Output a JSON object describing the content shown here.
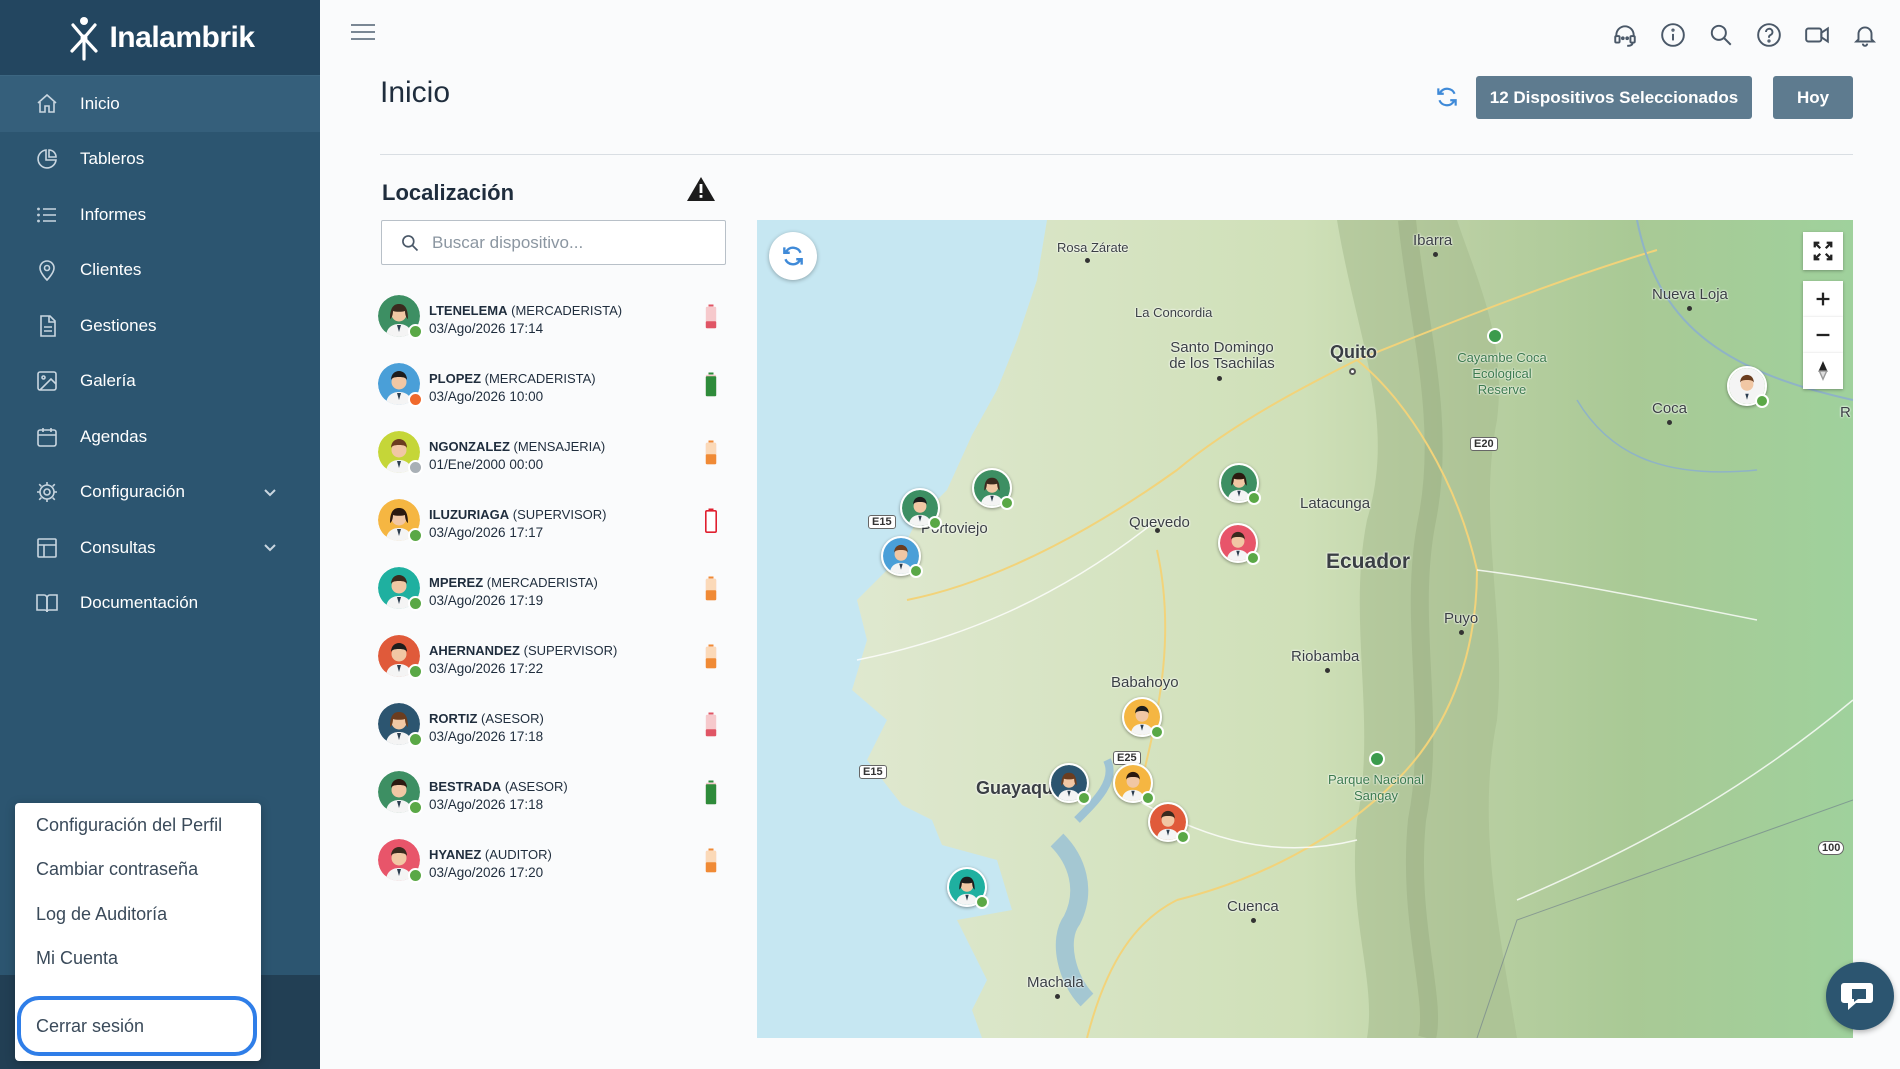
{
  "app": {
    "brand": "Inalambrik"
  },
  "sidebar": {
    "items": [
      {
        "label": "Inicio",
        "icon": "home-icon",
        "active": true
      },
      {
        "label": "Tableros",
        "icon": "pie-chart-icon"
      },
      {
        "label": "Informes",
        "icon": "list-icon"
      },
      {
        "label": "Clientes",
        "icon": "location-pin-icon"
      },
      {
        "label": "Gestiones",
        "icon": "document-icon"
      },
      {
        "label": "Galería",
        "icon": "image-icon"
      },
      {
        "label": "Agendas",
        "icon": "calendar-icon"
      },
      {
        "label": "Configuración",
        "icon": "gear-icon",
        "expandable": true
      },
      {
        "label": "Consultas",
        "icon": "table-icon",
        "expandable": true
      },
      {
        "label": "Documentación",
        "icon": "book-icon"
      }
    ]
  },
  "profile_menu": {
    "items": [
      "Configuración del Perfil",
      "Cambiar contraseña",
      "Log de Auditoría",
      "Mi Cuenta"
    ],
    "logout": "Cerrar sesión"
  },
  "header": {
    "title": "Inicio",
    "devices_button": "12 Dispositivos Seleccionados",
    "today_button": "Hoy",
    "icons": [
      "headset-icon",
      "info-icon",
      "search-icon",
      "help-icon",
      "video-icon",
      "bell-icon"
    ]
  },
  "localization": {
    "title": "Localización",
    "search_placeholder": "Buscar dispositivo...",
    "devices": [
      {
        "user": "LTENELEMA",
        "role": "(MERCADERISTA)",
        "date": "03/Ago/2026 17:14",
        "status_color": "#5aa846",
        "battery": "low",
        "battery_color": "#e05565",
        "avatar_bg": "#3d8f63"
      },
      {
        "user": "PLOPEZ",
        "role": "(MERCADERISTA)",
        "date": "03/Ago/2026 10:00",
        "status_color": "#f0692c",
        "battery": "full",
        "battery_color": "#2e8b3a",
        "avatar_bg": "#4a9fd8"
      },
      {
        "user": "NGONZALEZ",
        "role": "(MENSAJERIA)",
        "date": "01/Ene/2000 00:00",
        "status_color": "#a9b0b6",
        "battery": "medium",
        "battery_color": "#f08a35",
        "avatar_bg": "#c5d638"
      },
      {
        "user": "ILUZURIAGA",
        "role": "(SUPERVISOR)",
        "date": "03/Ago/2026 17:17",
        "status_color": "#5aa846",
        "battery": "empty",
        "battery_color": "#e02030",
        "avatar_bg": "#f5b642"
      },
      {
        "user": "MPEREZ",
        "role": "(MERCADERISTA)",
        "date": "03/Ago/2026 17:19",
        "status_color": "#5aa846",
        "battery": "medium",
        "battery_color": "#f08a35",
        "avatar_bg": "#1fb0a0"
      },
      {
        "user": "AHERNANDEZ",
        "role": "(SUPERVISOR)",
        "date": "03/Ago/2026 17:22",
        "status_color": "#5aa846",
        "battery": "medium",
        "battery_color": "#f08a35",
        "avatar_bg": "#e05a3a"
      },
      {
        "user": "RORTIZ",
        "role": "(ASESOR)",
        "date": "03/Ago/2026 17:18",
        "status_color": "#5aa846",
        "battery": "low",
        "battery_color": "#e05565",
        "avatar_bg": "#2c5570"
      },
      {
        "user": "BESTRADA",
        "role": "(ASESOR)",
        "date": "03/Ago/2026 17:18",
        "status_color": "#5aa846",
        "battery": "full",
        "battery_color": "#2e8b3a",
        "avatar_bg": "#3d8f63"
      },
      {
        "user": "HYANEZ",
        "role": "(AUDITOR)",
        "date": "03/Ago/2026 17:20",
        "status_color": "#5aa846",
        "battery": "medium",
        "battery_color": "#f08a35",
        "avatar_bg": "#e8556a"
      }
    ]
  },
  "map": {
    "labels": {
      "rosa_zarate": "Rosa Zárate",
      "ibarra": "Ibarra",
      "la_concordia": "La Concordia",
      "santo_domingo": "Santo Domingo de los Tsachilas",
      "quito": "Quito",
      "cayambe": "Cayambe Coca Ecological Reserve",
      "nueva_loja": "Nueva Loja",
      "coca": "Coca",
      "portoviejo": "Portoviejo",
      "quevedo": "Quevedo",
      "latacunga": "Latacunga",
      "ecuador": "Ecuador",
      "puyo": "Puyo",
      "riobamba": "Riobamba",
      "babahoyo": "Babahoyo",
      "guayaquil": "Guayaqu",
      "sangay": "Parque Nacional Sangay",
      "cuenca": "Cuenca",
      "machala": "Machala",
      "r_edge": "R"
    },
    "roads": {
      "e15a": "E15",
      "e15b": "E15",
      "e20": "E20",
      "e25": "E25",
      "r100": "100"
    }
  }
}
